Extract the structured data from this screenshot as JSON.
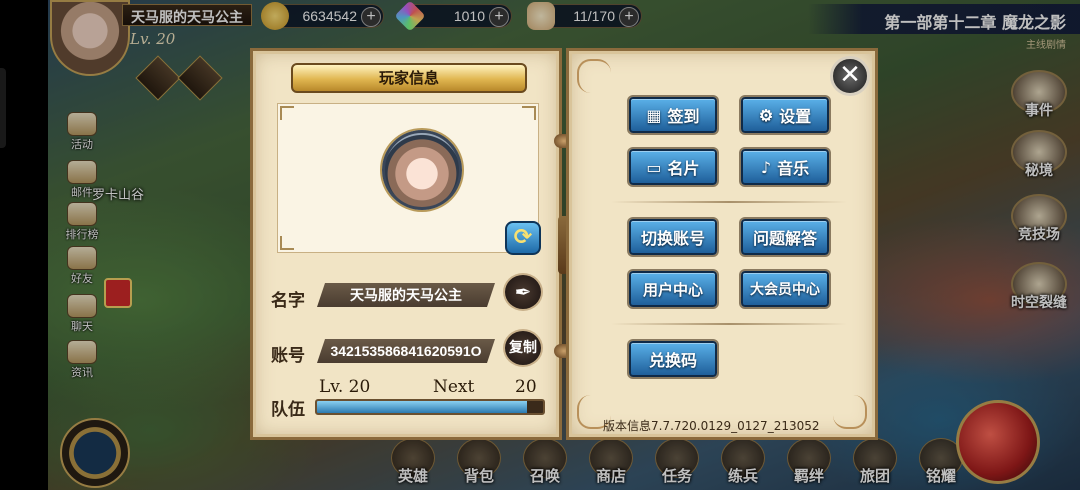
{
  "top_bar": {
    "player_name": "天马服的天马公主",
    "player_level": "Lv. 20",
    "gold": "6634542",
    "gems": "1010",
    "stamina": "11/170",
    "chapter_title": "第一部第十二章 魔龙之影",
    "chapter_sub": "主线剧情"
  },
  "left_menu": [
    {
      "label": "活动",
      "icon": "event-scroll-icon"
    },
    {
      "label": "邮件",
      "icon": "mail-icon"
    },
    {
      "label": "排行榜",
      "icon": "ranking-icon"
    },
    {
      "label": "好友",
      "icon": "friends-icon"
    },
    {
      "label": "聊天",
      "icon": "chat-icon"
    },
    {
      "label": "资讯",
      "icon": "news-icon"
    }
  ],
  "map_location": "罗卡山谷",
  "right_menu": [
    {
      "label": "事件",
      "icon": "event-icon"
    },
    {
      "label": "秘境",
      "icon": "secret-realm-icon"
    },
    {
      "label": "竞技场",
      "icon": "arena-swords-icon"
    },
    {
      "label": "时空裂缝",
      "icon": "rift-icon"
    }
  ],
  "bottom_menu": [
    "英雄",
    "背包",
    "召唤",
    "商店",
    "任务",
    "练兵",
    "羁绊",
    "旅团",
    "铭耀"
  ],
  "dialog": {
    "title": "玩家信息",
    "name_label": "名字",
    "name_value": "天马服的天马公主",
    "account_label": "账号",
    "account_value": "342153586841620591O",
    "copy_label": "复制",
    "team_label": "队伍",
    "team_level": "Lv. 20",
    "next_label": "Next",
    "next_value": "20",
    "xp_fraction": 0.93,
    "buttons": {
      "signin": "签到",
      "settings": "设置",
      "card": "名片",
      "music": "音乐",
      "switch_account": "切换账号",
      "faq": "问题解答",
      "user_center": "用户中心",
      "vip_center": "大会员中心",
      "redeem": "兑换码"
    },
    "version": "版本信息7.7.720.0129_0127_213052"
  }
}
